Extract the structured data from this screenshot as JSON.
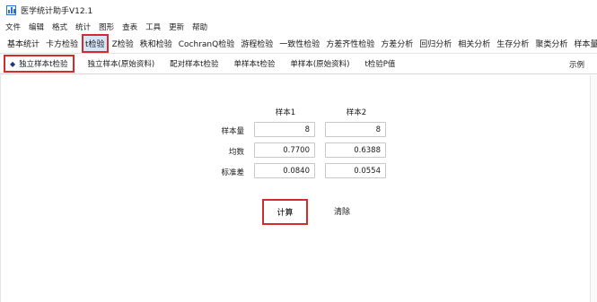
{
  "window": {
    "title": "医学统计助手V12.1",
    "icon": "bar-chart-icon"
  },
  "menubar": [
    "文件",
    "编辑",
    "格式",
    "统计",
    "图形",
    "查表",
    "工具",
    "更新",
    "帮助"
  ],
  "toolbar": {
    "items": [
      "基本统计",
      "卡方检验",
      "t检验",
      "Z检验",
      "秩和检验",
      "CochranQ检验",
      "游程检验",
      "一致性检验",
      "方差齐性检验",
      "方差分析",
      "回归分析",
      "相关分析",
      "生存分析",
      "聚类分析",
      "样本量估算"
    ],
    "active_index": 2
  },
  "subtabs": {
    "items": [
      "独立样本t检验",
      "独立样本(原始资料)",
      "配对样本t检验",
      "单样本t检验",
      "单样本(原始资料)",
      "t检验P值"
    ],
    "active_index": 0,
    "example_link": "示例"
  },
  "form": {
    "columns": [
      "样本1",
      "样本2"
    ],
    "rows": [
      {
        "label": "样本量",
        "values": [
          "8",
          "8"
        ]
      },
      {
        "label": "均数",
        "values": [
          "0.7700",
          "0.6388"
        ]
      },
      {
        "label": "标准差",
        "values": [
          "0.0840",
          "0.0554"
        ]
      }
    ]
  },
  "actions": {
    "calculate": "计算",
    "clear": "清除"
  },
  "colors": {
    "highlight_border": "#d32c2c",
    "active_tab_bg": "#d6e6f8"
  }
}
